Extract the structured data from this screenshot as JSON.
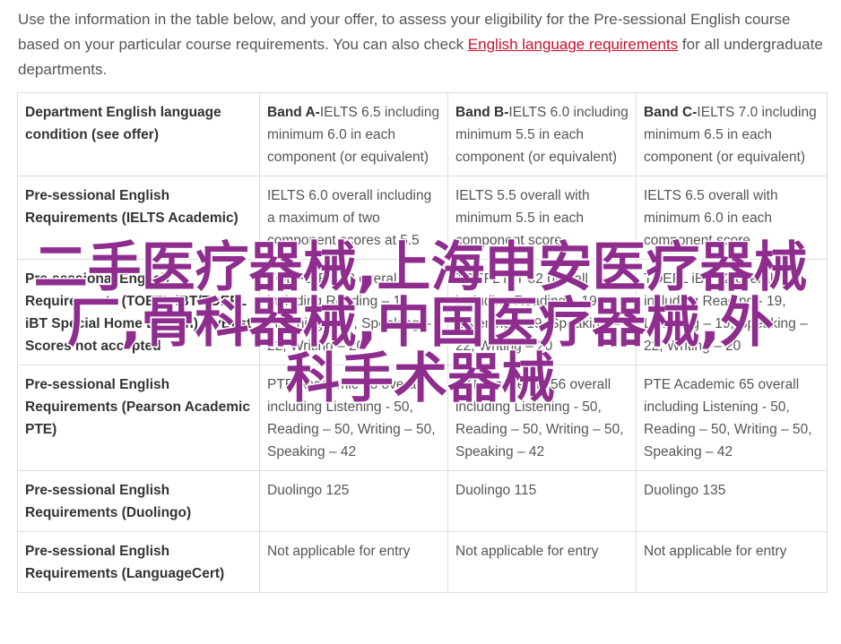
{
  "intro": {
    "text_before_link": "Use the information in the table below, and your offer, to assess your eligibility for the Pre-sessional English course based on your particular course requirements. You can also check ",
    "link_text": "English language requirements",
    "text_after_link": " for all undergraduate departments."
  },
  "table": {
    "header": {
      "condition_label": "Department English language condition (see offer)",
      "bands": [
        {
          "name": "Band A-",
          "detail": "IELTS 6.5 including minimum 6.0 in each component (or equivalent)"
        },
        {
          "name": "Band B-",
          "detail": "IELTS 6.0 including minimum 5.5 in each component (or equivalent)"
        },
        {
          "name": "Band C-",
          "detail": "IELTS 7.0 including minimum 6.5 in each component (or equivalent)"
        }
      ]
    },
    "rows": [
      {
        "label": "Pre-sessional English Requirements (IELTS Academic)",
        "cells": [
          "IELTS 6.0 overall including a maximum of two component scores at 5.5",
          "IELTS 5.5 overall with minimum 5.5 in each component score",
          "IELTS 6.5 overall with minimum 6.0 in each component score"
        ]
      },
      {
        "label": "Pre-sessional English Requirements (TOEFL iBT/TOEFL iBT Special Home Edition) MyBest Scores not accepted",
        "cells": [
          "TOEFL iBT 82 overall including Reading – 19, Listening – 19, Speaking – 22, Writing – 20",
          "TOEFL iBT 82 overall including Reading – 19, Listening – 19, Speaking – 22, Writing – 20",
          "TOEFL iBT 92 overall including Reading - 19, Listening – 19, Speaking – 22, Writing – 20"
        ]
      },
      {
        "label": "Pre-sessional English Requirements (Pearson Academic PTE)",
        "cells": [
          "PTE Academic 58 overall including Listening - 50, Reading – 50, Writing – 50, Speaking – 42",
          "PTE Academic 56 overall including Listening - 50, Reading – 50, Writing – 50, Speaking – 42",
          "PTE Academic 65 overall including Listening - 50, Reading – 50, Writing – 50, Speaking – 42"
        ]
      },
      {
        "label": "Pre-sessional English Requirements (Duolingo)",
        "cells": [
          "Duolingo 125",
          "Duolingo 115",
          "Duolingo 135"
        ]
      },
      {
        "label": "Pre-sessional English Requirements (LanguageCert)",
        "cells": [
          "Not applicable for entry",
          "Not applicable for entry",
          "Not applicable for entry"
        ]
      }
    ]
  },
  "watermark": {
    "lines": [
      "二手医疗器械,上海申安医疗器械",
      "厂,骨科器械,中国医疗器械,外",
      "科手术器械"
    ],
    "color": "#8e2d8e"
  },
  "colors": {
    "link": "#c8102e",
    "text": "#555555",
    "border": "#dddddd"
  }
}
